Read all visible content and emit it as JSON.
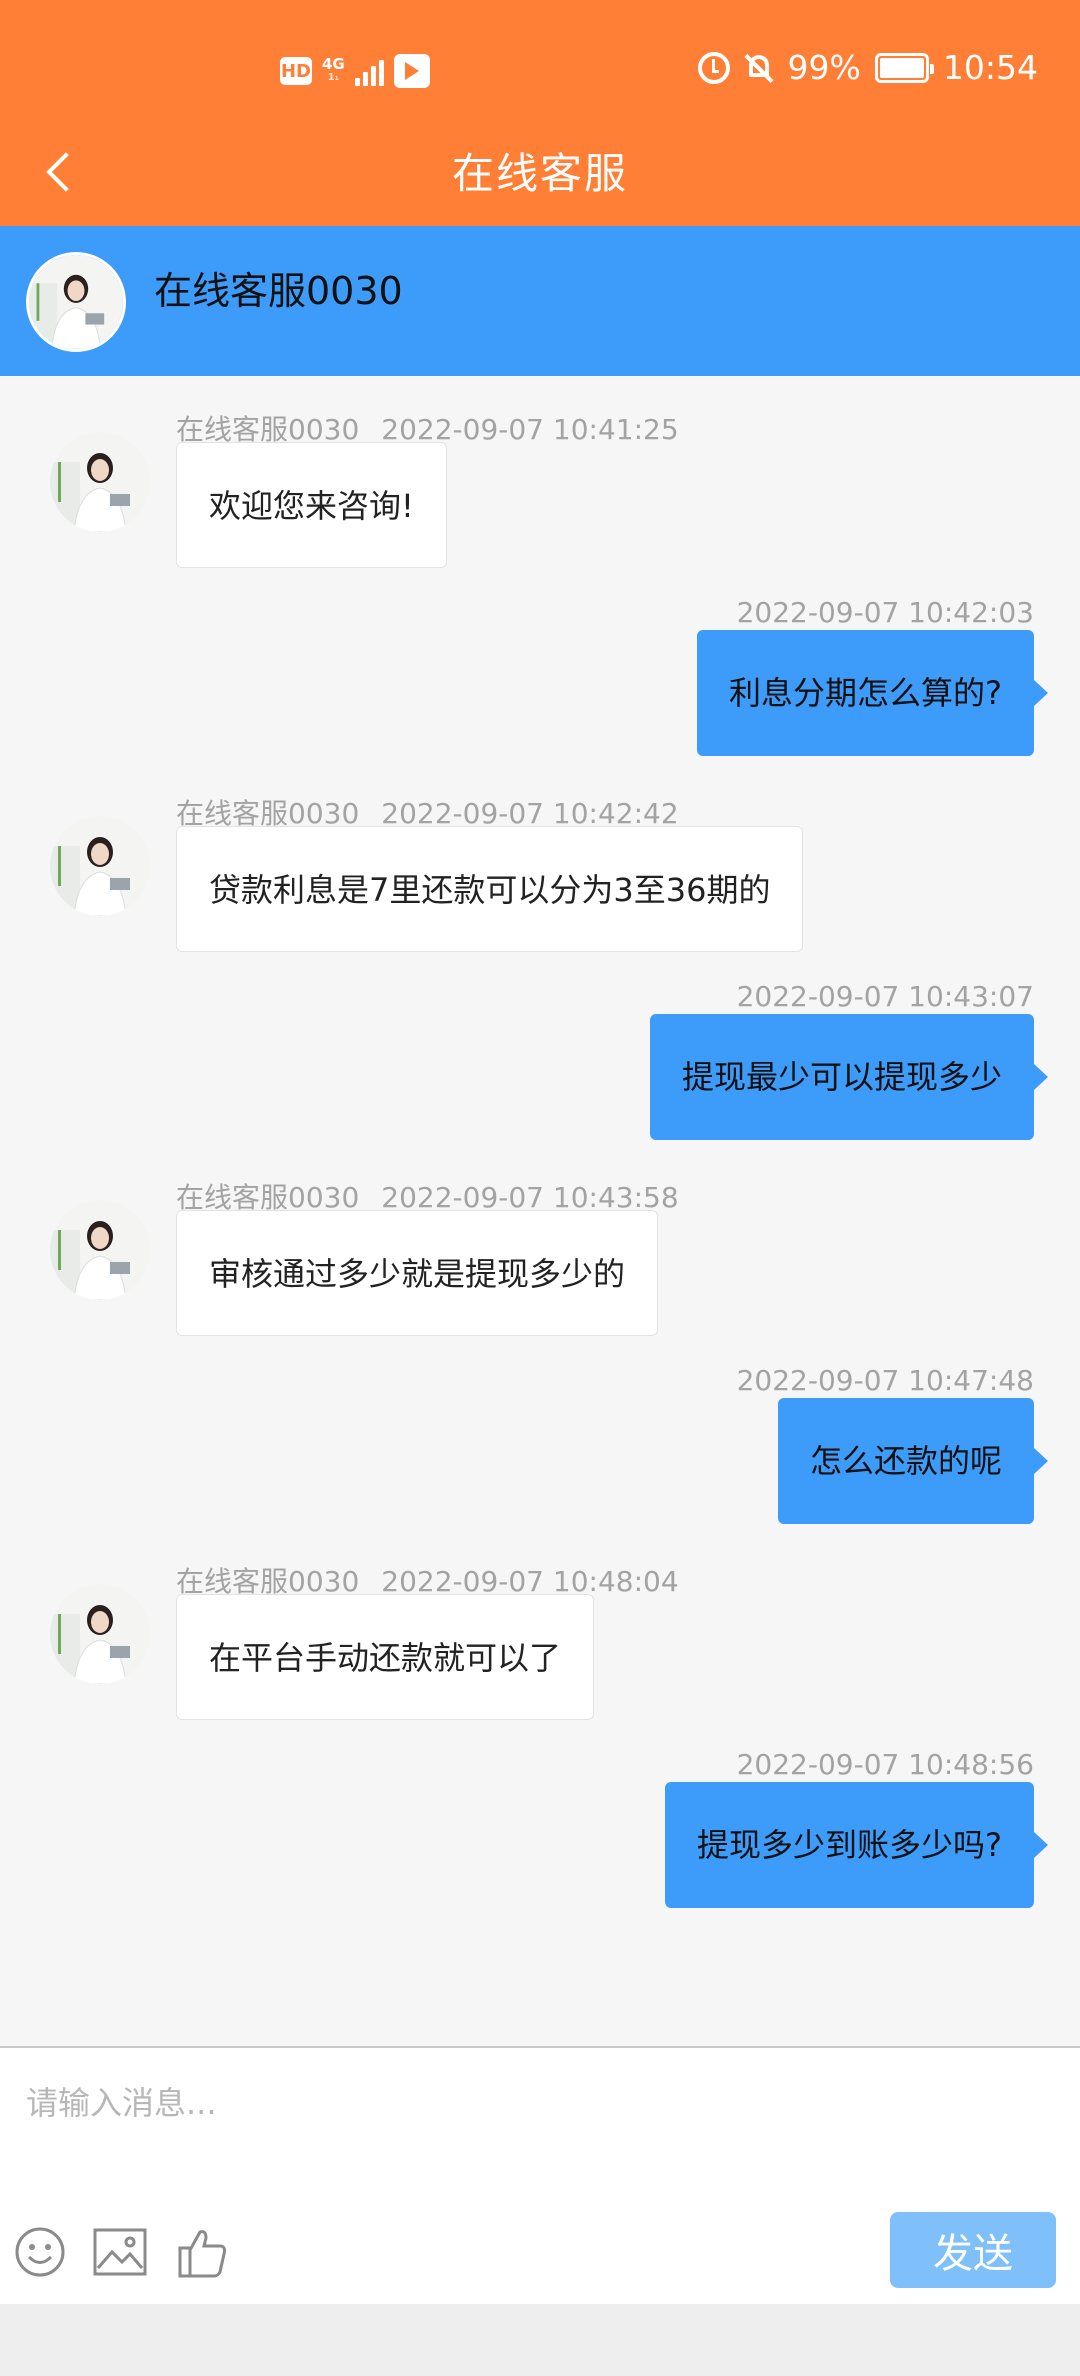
{
  "status_bar": {
    "hd": "HD",
    "network": "4G",
    "network_sub": "1₁",
    "battery_pct": "99%",
    "time": "10:54"
  },
  "header": {
    "title": "在线客服"
  },
  "agent": {
    "name": "在线客服0030"
  },
  "messages": [
    {
      "from": "agent",
      "sender": "在线客服0030",
      "time": "2022-09-07 10:41:25",
      "text": "欢迎您来咨询!"
    },
    {
      "from": "user",
      "time": "2022-09-07 10:42:03",
      "text": "利息分期怎么算的?"
    },
    {
      "from": "agent",
      "sender": "在线客服0030",
      "time": "2022-09-07 10:42:42",
      "text": "贷款利息是7里还款可以分为3至36期的"
    },
    {
      "from": "user",
      "time": "2022-09-07 10:43:07",
      "text": "提现最少可以提现多少"
    },
    {
      "from": "agent",
      "sender": "在线客服0030",
      "time": "2022-09-07 10:43:58",
      "text": "审核通过多少就是提现多少的"
    },
    {
      "from": "user",
      "time": "2022-09-07 10:47:48",
      "text": "怎么还款的呢"
    },
    {
      "from": "agent",
      "sender": "在线客服0030",
      "time": "2022-09-07 10:48:04",
      "text": "在平台手动还款就可以了"
    },
    {
      "from": "user",
      "time": "2022-09-07 10:48:56",
      "text": "提现多少到账多少吗?"
    }
  ],
  "composer": {
    "placeholder": "请输入消息...",
    "send_label": "发送",
    "tools": [
      "emoji-icon",
      "image-icon",
      "thumbs-up-icon"
    ]
  },
  "colors": {
    "header": "#ff7f36",
    "agent_bar": "#3d9bfa",
    "user_bubble": "#3d9bfa",
    "send_button": "#7fc0fb"
  }
}
